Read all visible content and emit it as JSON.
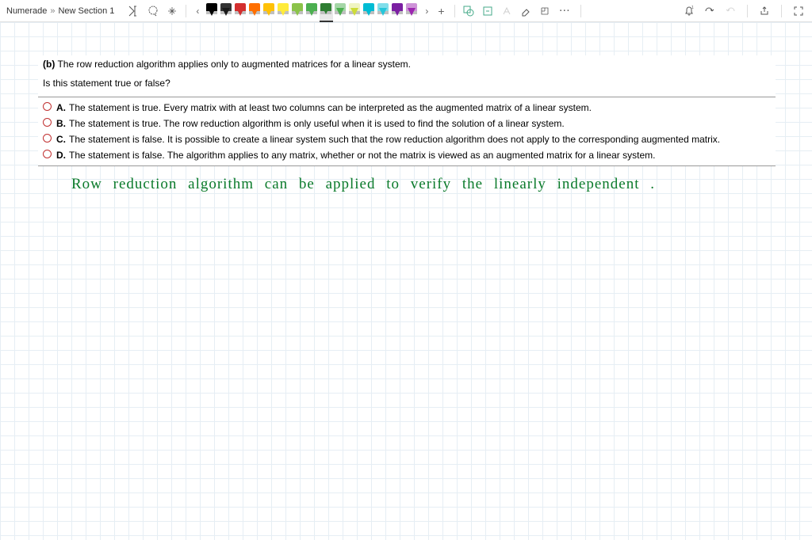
{
  "breadcrumb": {
    "root": "Numerade",
    "section": "New Section 1"
  },
  "toolbar": {
    "text_tool": "text-cursor-icon",
    "lasso": "lasso-select-icon",
    "hand": "hand-tool-icon",
    "nav_prev": "‹",
    "nav_next": "›",
    "plus": "+",
    "ellipsis": "···"
  },
  "pens": [
    {
      "tip": "#000000",
      "body": "#000000"
    },
    {
      "tip": "#1a1a1a",
      "body": "#333333"
    },
    {
      "tip": "#d32f2f",
      "body": "#d32f2f"
    },
    {
      "tip": "#ff6f00",
      "body": "#ff6f00"
    },
    {
      "tip": "#ffc107",
      "body": "#ffc107"
    },
    {
      "tip": "#ffeb3b",
      "body": "#ffeb3b"
    },
    {
      "tip": "#8bc34a",
      "body": "#8bc34a"
    },
    {
      "tip": "#4caf50",
      "body": "#4caf50"
    },
    {
      "tip": "#2e7d32",
      "body": "#2e7d32",
      "selected": true
    },
    {
      "tip": "#4caf50",
      "body": "#a5d6a7"
    },
    {
      "tip": "#cddc39",
      "body": "#f0f4c3"
    },
    {
      "tip": "#00bcd4",
      "body": "#00bcd4"
    },
    {
      "tip": "#26c6da",
      "body": "#80deea"
    },
    {
      "tip": "#7b1fa2",
      "body": "#7b1fa2"
    },
    {
      "tip": "#9c27b0",
      "body": "#ce93d8"
    }
  ],
  "question": {
    "prefix": "(b)",
    "stem": "The row reduction algorithm applies only to augmented matrices for a linear system.",
    "prompt": "Is this statement true or false?",
    "options": [
      {
        "letter": "A.",
        "text": "The statement is true. Every matrix with at least two columns can be interpreted as the augmented matrix of a linear system."
      },
      {
        "letter": "B.",
        "text": "The statement is true. The row reduction algorithm is only useful when it is used to find the solution of a linear system."
      },
      {
        "letter": "C.",
        "text": "The statement is false. It is possible to create a linear system such that the row reduction algorithm does not apply to the corresponding augmented matrix."
      },
      {
        "letter": "D.",
        "text": "The statement is false. The algorithm applies to any matrix, whether or not the matrix is viewed as an augmented matrix for a linear system."
      }
    ]
  },
  "handwritten_note": "Row  reduction  algorithm  can  be   applied   to   verify   the   linearly  independent ."
}
